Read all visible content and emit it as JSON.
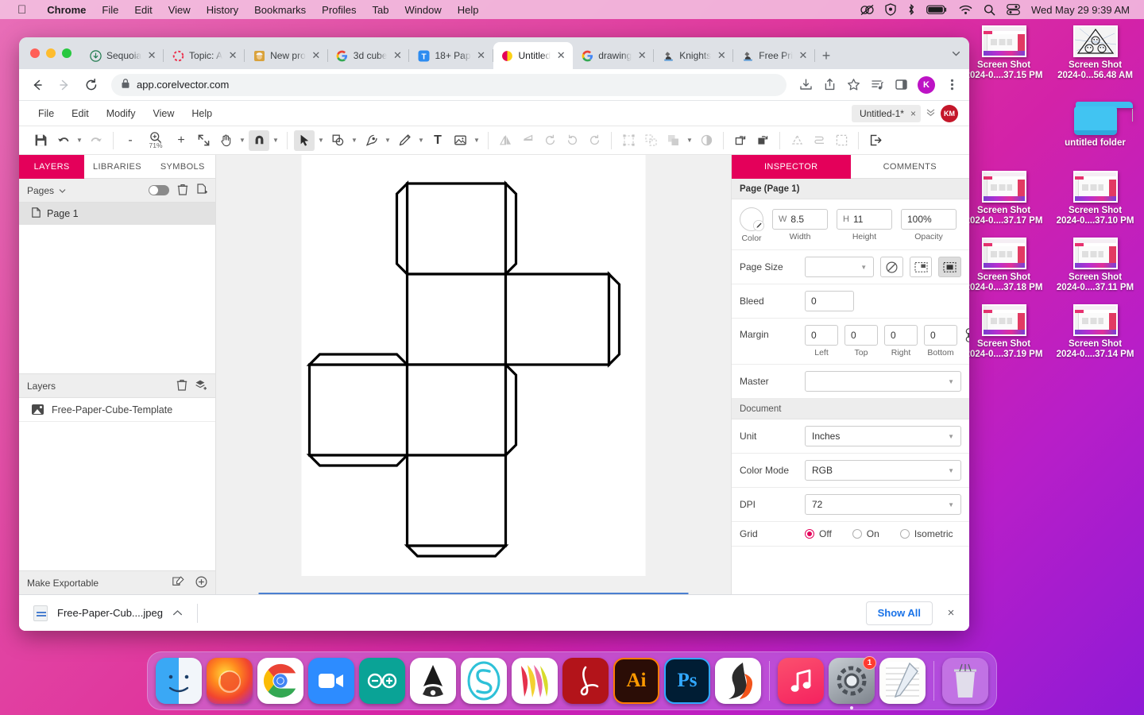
{
  "menubar": {
    "apple_icon": "apple-logo-icon",
    "items": [
      {
        "label": "Chrome",
        "bold": true
      },
      {
        "label": "File",
        "bold": false
      },
      {
        "label": "Edit",
        "bold": false
      },
      {
        "label": "View",
        "bold": false
      },
      {
        "label": "History",
        "bold": false
      },
      {
        "label": "Bookmarks",
        "bold": false
      },
      {
        "label": "Profiles",
        "bold": false
      },
      {
        "label": "Tab",
        "bold": false
      },
      {
        "label": "Window",
        "bold": false
      },
      {
        "label": "Help",
        "bold": false
      }
    ],
    "status_icons": [
      "creative-cloud-icon",
      "shield-icon",
      "bluetooth-icon",
      "battery-icon",
      "wifi-icon",
      "search-icon",
      "control-center-icon"
    ],
    "clock": "Wed May 29  9:39 AM"
  },
  "desktop": {
    "icons": [
      {
        "name": "Screen Shot",
        "subtitle": "2024-0....37.15 PM",
        "type": "screenshot"
      },
      {
        "name": "Screen Shot",
        "subtitle": "2024-0...56.48 AM",
        "type": "triangle"
      },
      {
        "name": "untitled folder",
        "subtitle": "",
        "type": "folder"
      },
      {
        "name": "Screen Shot",
        "subtitle": "2024-0....37.17 PM",
        "type": "screenshot"
      },
      {
        "name": "Screen Shot",
        "subtitle": "2024-0....37.10 PM",
        "type": "screenshot"
      },
      {
        "name": "Screen Shot",
        "subtitle": "2024-0....37.18 PM",
        "type": "screenshot"
      },
      {
        "name": "Screen Shot",
        "subtitle": "2024-0....37.11 PM",
        "type": "screenshot"
      },
      {
        "name": "Screen Shot",
        "subtitle": "2024-0....37.19 PM",
        "type": "screenshot"
      },
      {
        "name": "Screen Shot",
        "subtitle": "2024-0....37.14 PM",
        "type": "screenshot"
      }
    ]
  },
  "browser": {
    "tabs": [
      {
        "label": "Sequoia",
        "favicon": "download-circle-icon",
        "active": false
      },
      {
        "label": "Topic: A",
        "favicon": "dashed-circle-icon",
        "active": false
      },
      {
        "label": "New pro",
        "favicon": "construction-worker-icon",
        "active": false
      },
      {
        "label": "3d cube",
        "favicon": "google-icon",
        "active": false
      },
      {
        "label": "18+ Pap",
        "favicon": "t-square-icon",
        "active": false
      },
      {
        "label": "Untitled",
        "favicon": "corelvector-icon",
        "active": true
      },
      {
        "label": "drawing",
        "favicon": "google-icon",
        "active": false
      },
      {
        "label": "Knights",
        "favicon": "microscope-icon",
        "active": false
      },
      {
        "label": "Free Pri",
        "favicon": "microscope-icon",
        "active": false
      }
    ],
    "new_tab_label": "+",
    "tab_list_chevron": "chevron-down-icon",
    "url": "app.corelvector.com",
    "url_lock": "lock-icon",
    "nav": {
      "back": "back-arrow-icon",
      "forward": "forward-arrow-icon",
      "reload": "reload-icon"
    },
    "toolbar_icons": [
      "download-icon",
      "share-icon",
      "bookmark-star-icon",
      "media-list-icon",
      "side-panel-icon"
    ],
    "profile_initial": "K",
    "menu_icon": "three-dot-menu-icon"
  },
  "app": {
    "menu": [
      "File",
      "Edit",
      "Modify",
      "View",
      "Help"
    ],
    "document_chip": {
      "label": "Untitled-1*",
      "close": "×"
    },
    "chip_chevron": "chevron-double-down-icon",
    "avatar_initials": "KM",
    "toolbar": {
      "save": "save-icon",
      "undo": "undo-icon",
      "redo": "redo-icon",
      "zoom_out": "-",
      "zoom_label": "71%",
      "zoom_in": "+",
      "fit": "fit-screen-icon",
      "pan": "hand-icon",
      "snap": "magnet-icon",
      "select": "pointer-icon",
      "shape": "shape-icon",
      "pen": "pen-icon",
      "pencil": "pencil-icon",
      "text": "T",
      "image": "image-icon",
      "flip_h": "flip-horizontal-icon",
      "flip_v": "flip-vertical-icon",
      "rotate_ccw": "rotate-ccw-icon",
      "rotate_cw": "rotate-cw-icon",
      "rotate_more": "rotate-more-icon",
      "group": "group-icon",
      "ungroup": "ungroup-icon",
      "arrange": "arrange-icon",
      "mask": "mask-icon",
      "duplicate": "duplicate-icon",
      "duplicate2": "duplicate-alt-icon",
      "boolean": "boolean-icon",
      "path": "path-icon",
      "marquee": "marquee-icon",
      "export": "export-icon"
    }
  },
  "left_panel": {
    "tabs": [
      {
        "label": "LAYERS",
        "active": true
      },
      {
        "label": "LIBRARIES",
        "active": false
      },
      {
        "label": "SYMBOLS",
        "active": false
      }
    ],
    "pages_header": {
      "label": "Pages",
      "chevron": "chevron-down-icon",
      "toggle": "visibility-toggle",
      "delete": "trash-icon",
      "add": "add-page-icon"
    },
    "pages": [
      {
        "label": "Page 1",
        "icon": "page-icon"
      }
    ],
    "layers_header": {
      "label": "Layers",
      "delete": "trash-icon",
      "add": "add-layer-icon"
    },
    "layers": [
      {
        "label": "Free-Paper-Cube-Template",
        "icon": "image-thumb-icon"
      }
    ],
    "make_exportable": {
      "label": "Make Exportable",
      "edit_icon": "export-settings-icon",
      "add_icon": "plus-circle-icon"
    }
  },
  "inspector": {
    "tabs": [
      {
        "label": "INSPECTOR",
        "active": true
      },
      {
        "label": "COMMENTS",
        "active": false
      }
    ],
    "page_section_title": "Page (Page 1)",
    "color": {
      "label": "Color",
      "icon": "eyedropper-icon"
    },
    "width": {
      "prefix": "W",
      "value": "8.5",
      "label": "Width"
    },
    "height": {
      "prefix": "H",
      "value": "11",
      "label": "Height"
    },
    "opacity": {
      "value": "100%",
      "label": "Opacity"
    },
    "page_size": {
      "label": "Page Size",
      "value": "",
      "buttons": [
        "no-size-icon",
        "landscape-icon",
        "portrait-icon"
      ],
      "active_index": 2
    },
    "bleed": {
      "label": "Bleed",
      "value": "0"
    },
    "margin": {
      "label": "Margin",
      "values": [
        "0",
        "0",
        "0",
        "0"
      ],
      "sublabels": [
        "Left",
        "Top",
        "Right",
        "Bottom"
      ],
      "link_icon": "link-margins-icon"
    },
    "master": {
      "label": "Master",
      "value": ""
    },
    "document_section_title": "Document",
    "unit": {
      "label": "Unit",
      "value": "Inches"
    },
    "color_mode": {
      "label": "Color Mode",
      "value": "RGB"
    },
    "dpi": {
      "label": "DPI",
      "value": "72"
    },
    "grid": {
      "label": "Grid",
      "options": [
        "Off",
        "On",
        "Isometric"
      ],
      "selected": "Off"
    },
    "accent_color": "#e4005a"
  },
  "canvas": {
    "artwork_name": "Free-Paper-Cube-Template",
    "description": "Cube net template with glue tabs"
  },
  "download_bar": {
    "file_name": "Free-Paper-Cub....jpeg",
    "file_icon": "jpeg-file-icon",
    "caret": "chevron-up-icon",
    "show_all": "Show All",
    "close": "×"
  },
  "dock": {
    "apps": [
      {
        "name": "Finder",
        "running": true
      },
      {
        "name": "Firefox",
        "running": true
      },
      {
        "name": "Google Chrome",
        "running": false
      },
      {
        "name": "Zoom",
        "running": false
      },
      {
        "name": "Arduino",
        "running": false
      },
      {
        "name": "Inkscape",
        "running": false
      },
      {
        "name": "Sketch",
        "running": false
      },
      {
        "name": "Affinity",
        "running": false
      },
      {
        "name": "Adobe Acrobat",
        "running": false
      },
      {
        "name": "Adobe Illustrator",
        "running": false
      },
      {
        "name": "Adobe Photoshop",
        "running": false
      },
      {
        "name": "Shapr3D",
        "running": false
      },
      {
        "name": "Music",
        "running": true
      },
      {
        "name": "System Settings",
        "running": true,
        "badge": "1"
      },
      {
        "name": "Notes",
        "running": false
      },
      {
        "name": "Trash",
        "running": false
      }
    ]
  }
}
